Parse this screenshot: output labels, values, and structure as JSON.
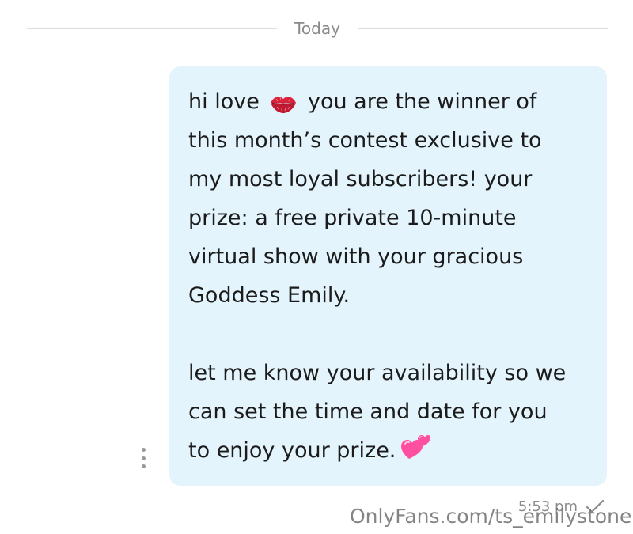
{
  "date_divider": {
    "label": "Today"
  },
  "message": {
    "intro_text": "hi love",
    "intro_rest": "you are the winner of",
    "lines": [
      "this month’s contest exclusive to",
      "my most loyal subscribers! your",
      "prize: a free private 10-minute",
      "virtual show with your gracious",
      "Goddess Emily."
    ],
    "paragraph2": [
      "let me know your availability so we",
      "can set the time and date for you"
    ],
    "last_line": "to enjoy your prize.",
    "emoji_1": "kiss-mark-icon",
    "emoji_2": "two-hearts-icon",
    "time": "5:53 pm",
    "status_icon": "check-icon"
  },
  "watermark": {
    "text": "OnlyFans.com/ts_emilystone"
  },
  "colors": {
    "bubble": "#e3f4fc",
    "divider_line": "#dcdcdc",
    "lips": "#d8213c",
    "hearts": "#ff4fa0"
  }
}
